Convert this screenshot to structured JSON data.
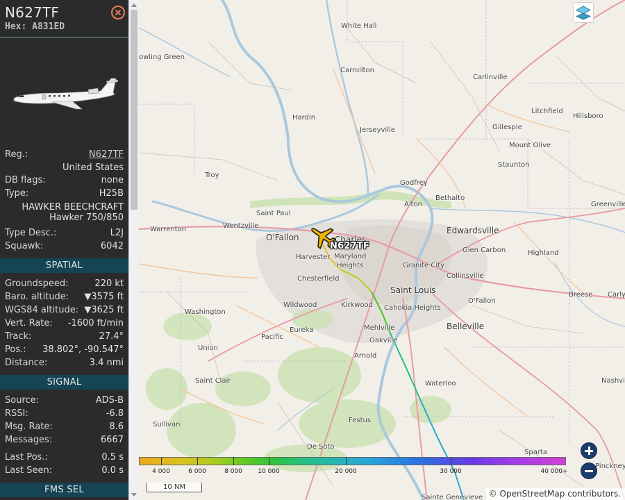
{
  "header": {
    "callsign": "N627TF",
    "hex": "Hex: A831ED"
  },
  "info": {
    "reg_label": "Reg.:",
    "reg_value": "N627TF",
    "country": "United States",
    "dbflags_label": "DB flags:",
    "dbflags_value": "none",
    "type_label": "Type:",
    "type_value": "H25B",
    "model_line1": "HAWKER BEECHCRAFT",
    "model_line2": "Hawker 750/850",
    "typedesc_label": "Type Desc.:",
    "typedesc_value": "L2J",
    "squawk_label": "Squawk:",
    "squawk_value": "6042"
  },
  "spatial": {
    "title": "SPATIAL",
    "groundspeed_label": "Groundspeed:",
    "groundspeed_value": "220 kt",
    "baro_label": "Baro. altitude:",
    "baro_value": "▼3575 ft",
    "wgs_label": "WGS84 altitude:",
    "wgs_value": "▼3625 ft",
    "vrate_label": "Vert. Rate:",
    "vrate_value": "-1600 ft/min",
    "track_label": "Track:",
    "track_value": "27.4°",
    "pos_label": "Pos.:",
    "pos_value": "38.802°, -90.547°",
    "distance_label": "Distance:",
    "distance_value": "3.4 nmi"
  },
  "signal": {
    "title": "SIGNAL",
    "source_label": "Source:",
    "source_value": "ADS-B",
    "rssi_label": "RSSI:",
    "rssi_value": "-6.8",
    "msgrate_label": "Msg. Rate:",
    "msgrate_value": "8.6",
    "messages_label": "Messages:",
    "messages_value": "6667",
    "lastpos_label": "Last Pos.:",
    "lastpos_value": "0.5 s",
    "lastseen_label": "Last Seen:",
    "lastseen_value": "0.0 s"
  },
  "fms": {
    "title": "FMS SEL"
  },
  "map": {
    "plane_label": "N627TF",
    "towns": [
      {
        "name": "White Hall",
        "big": false
      },
      {
        "name": "owling Green",
        "big": false
      },
      {
        "name": "Carrollton",
        "big": false
      },
      {
        "name": "Carlinville",
        "big": false
      },
      {
        "name": "Litchfield",
        "big": false
      },
      {
        "name": "Hillsboro",
        "big": false
      },
      {
        "name": "Hardin",
        "big": false
      },
      {
        "name": "Gillespie",
        "big": false
      },
      {
        "name": "Jerseyville",
        "big": false
      },
      {
        "name": "Mount Olive",
        "big": false
      },
      {
        "name": "Staunton",
        "big": false
      },
      {
        "name": "Troy",
        "big": false
      },
      {
        "name": "Godfrey",
        "big": false
      },
      {
        "name": "Bethalto",
        "big": false
      },
      {
        "name": "Alton",
        "big": false
      },
      {
        "name": "Greenville",
        "big": false
      },
      {
        "name": "Saint Paul",
        "big": false
      },
      {
        "name": "Warrenton",
        "big": false
      },
      {
        "name": "Wentzville",
        "big": false
      },
      {
        "name": "O'Fallon",
        "big": true
      },
      {
        "name": "Charles",
        "big": true
      },
      {
        "name": "Edwardsville",
        "big": true
      },
      {
        "name": "Glen Carbon",
        "big": false
      },
      {
        "name": "Harvester",
        "big": false
      },
      {
        "name": "Maryland",
        "big": false
      },
      {
        "name": "Heights",
        "big": false
      },
      {
        "name": "Granite City",
        "big": false
      },
      {
        "name": "Highland",
        "big": false
      },
      {
        "name": "Collinsville",
        "big": false
      },
      {
        "name": "Chesterfield",
        "big": false
      },
      {
        "name": "Saint Louis",
        "big": true
      },
      {
        "name": "Breese",
        "big": false
      },
      {
        "name": "Carlyl",
        "big": false
      },
      {
        "name": "Wildwood",
        "big": false
      },
      {
        "name": "Kirkwood",
        "big": false
      },
      {
        "name": "Cahokia Heights",
        "big": false
      },
      {
        "name": "O'Fallon",
        "big": false
      },
      {
        "name": "Washington",
        "big": false
      },
      {
        "name": "Mehlville",
        "big": false
      },
      {
        "name": "Belleville",
        "big": true
      },
      {
        "name": "Eureka",
        "big": false
      },
      {
        "name": "Pacific",
        "big": false
      },
      {
        "name": "Oakville",
        "big": false
      },
      {
        "name": "Union",
        "big": false
      },
      {
        "name": "Arnold",
        "big": false
      },
      {
        "name": "Saint Clair",
        "big": false
      },
      {
        "name": "Waterloo",
        "big": false
      },
      {
        "name": "Nashvil",
        "big": false
      },
      {
        "name": "Sullivan",
        "big": false
      },
      {
        "name": "Festus",
        "big": false
      },
      {
        "name": "De Soto",
        "big": false
      },
      {
        "name": "Sparta",
        "big": false
      },
      {
        "name": "Pinckney",
        "big": false
      },
      {
        "name": "Sainte Genevieve",
        "big": false
      }
    ],
    "legend_ticks": [
      "4 000",
      "6 000",
      "8 000",
      "10 000",
      "20 000",
      "30 000",
      "40 000+"
    ],
    "scale_label": "10 NM",
    "attrib_copy": "© ",
    "attrib_osm": "OpenStreetMap",
    "attrib_rest": " contributors."
  },
  "colors": {
    "sidebar_bg": "#2b2b2b",
    "section_bg": "#154455",
    "close": "#e87b5b",
    "plane": "#f2b400"
  },
  "icons": {
    "close": "close-icon",
    "layers": "layers-icon",
    "plane": "plane-icon",
    "zoom_in": "zoom-in-icon",
    "zoom_out": "zoom-out-icon"
  }
}
